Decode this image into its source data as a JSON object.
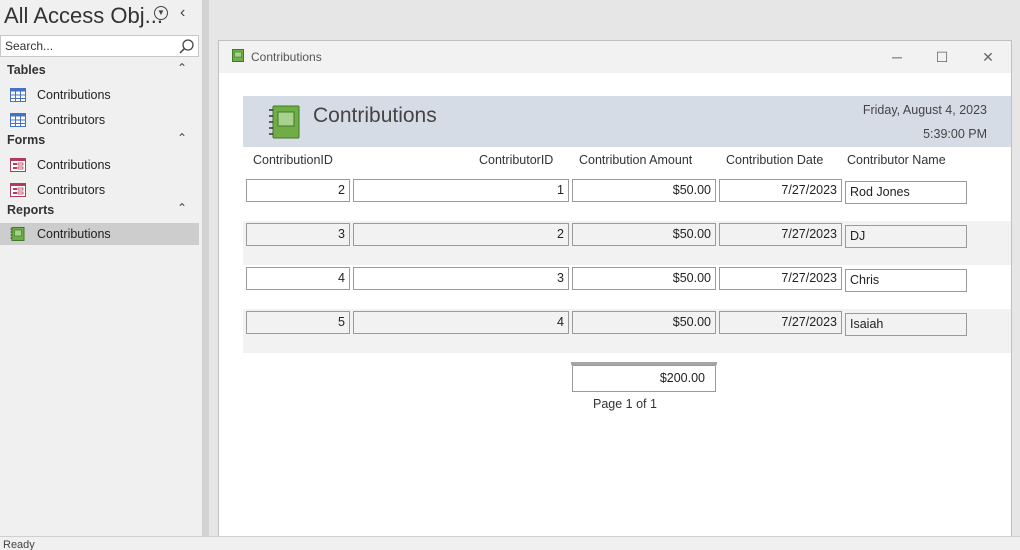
{
  "nav": {
    "title": "All Access Obj...",
    "search_placeholder": "Search...",
    "groups": [
      {
        "label": "Tables",
        "items": [
          {
            "label": "Contributions",
            "icon": "table-icon"
          },
          {
            "label": "Contributors",
            "icon": "table-icon"
          }
        ]
      },
      {
        "label": "Forms",
        "items": [
          {
            "label": "Contributions",
            "icon": "form-icon"
          },
          {
            "label": "Contributors",
            "icon": "form-icon"
          }
        ]
      },
      {
        "label": "Reports",
        "items": [
          {
            "label": "Contributions",
            "icon": "report-icon",
            "selected": true
          }
        ]
      }
    ]
  },
  "window": {
    "title": "Contributions",
    "minimize_glyph": "─",
    "maximize_glyph": "☐",
    "close_glyph": "✕"
  },
  "report": {
    "title": "Contributions",
    "date": "Friday, August 4, 2023",
    "time": "5:39:00 PM",
    "columns": [
      "ContributionID",
      "ContributorID",
      "Contribution Amount",
      "Contribution Date",
      "Contributor Name"
    ],
    "rows": [
      {
        "contribution_id": "2",
        "contributor_id": "1",
        "amount": "$50.00",
        "date": "7/27/2023",
        "name": "Rod Jones"
      },
      {
        "contribution_id": "3",
        "contributor_id": "2",
        "amount": "$50.00",
        "date": "7/27/2023",
        "name": "DJ"
      },
      {
        "contribution_id": "4",
        "contributor_id": "3",
        "amount": "$50.00",
        "date": "7/27/2023",
        "name": "Chris"
      },
      {
        "contribution_id": "5",
        "contributor_id": "4",
        "amount": "$50.00",
        "date": "7/27/2023",
        "name": "Isaiah"
      }
    ],
    "total": "$200.00",
    "page_label": "Page 1 of 1"
  },
  "status": {
    "text": "Ready"
  },
  "colors": {
    "header_band": "#d6dce5",
    "alt_row": "#f2f2f2",
    "selected_nav": "#cdcdcd",
    "report_icon_green": "#70ad47"
  }
}
